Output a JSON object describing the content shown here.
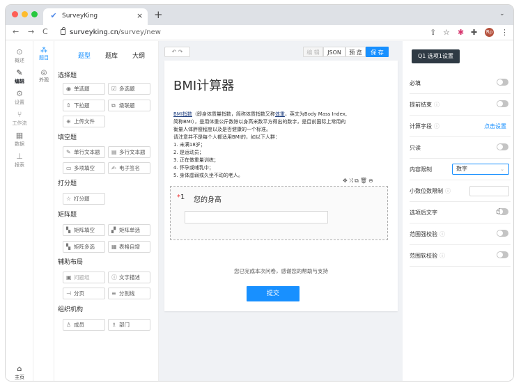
{
  "browser": {
    "tab_title": "SurveyKing",
    "tab_close": "×",
    "new_tab": "+",
    "tab_menu": "⌄",
    "nav": {
      "back": "←",
      "forward": "→",
      "reload": "C"
    },
    "url_host": "surveyking.cn",
    "url_path": "/survey/new",
    "ext_icons": [
      "⇧",
      "☆",
      "✱",
      "✚"
    ],
    "avatar": "Rp",
    "menu": "⋮",
    "traffic_light_colors": [
      "#fe5f57",
      "#febc2e",
      "#28c840"
    ]
  },
  "left_nav": {
    "items": [
      {
        "icon": "⊙",
        "label": "概述"
      },
      {
        "icon": "✎",
        "label": "编辑",
        "active": true
      },
      {
        "icon": "⚙",
        "label": "设置"
      },
      {
        "icon": "⑂",
        "label": "工作流"
      },
      {
        "icon": "▦",
        "label": "数据"
      },
      {
        "icon": "⊥",
        "label": "报表"
      }
    ],
    "home": {
      "icon": "⌂",
      "label": "主页"
    }
  },
  "sub_nav": {
    "items": [
      {
        "icon": "⁂",
        "label": "题目",
        "active": true
      },
      {
        "icon": "◎",
        "label": "外观"
      }
    ]
  },
  "palette": {
    "tabs": [
      "题型",
      "题库",
      "大纲"
    ],
    "groups": [
      {
        "title": "选择题",
        "items": [
          {
            "icon": "◉",
            "label": "单选题"
          },
          {
            "icon": "☑",
            "label": "多选题"
          },
          {
            "icon": "⇕",
            "label": "下拉题"
          },
          {
            "icon": "⧉",
            "label": "级联题"
          },
          {
            "icon": "⊕",
            "label": "上传文件"
          }
        ]
      },
      {
        "title": "填空题",
        "items": [
          {
            "icon": "✎",
            "label": "单行文本题"
          },
          {
            "icon": "▤",
            "label": "多行文本题"
          },
          {
            "icon": "▭",
            "label": "多项填空"
          },
          {
            "icon": "✍",
            "label": "电子签名"
          }
        ]
      },
      {
        "title": "打分题",
        "items": [
          {
            "icon": "☆",
            "label": "打分题"
          }
        ]
      },
      {
        "title": "矩阵题",
        "items": [
          {
            "icon": "▚",
            "label": "矩阵填空"
          },
          {
            "icon": "▞",
            "label": "矩阵单选"
          },
          {
            "icon": "▚",
            "label": "矩阵多选"
          },
          {
            "icon": "▦",
            "label": "表格自增"
          }
        ]
      },
      {
        "title": "辅助布局",
        "items": [
          {
            "icon": "▣",
            "label": "问题组",
            "disabled": true
          },
          {
            "icon": "ⓘ",
            "label": "文字描述"
          },
          {
            "icon": "⊣",
            "label": "分页"
          },
          {
            "icon": "≡",
            "label": "分割线"
          }
        ]
      },
      {
        "title": "组织机构",
        "items": [
          {
            "icon": "♙",
            "label": "成员"
          },
          {
            "icon": "♗",
            "label": "部门"
          }
        ]
      }
    ]
  },
  "canvas": {
    "undo": "↶ ↷",
    "toolbar": {
      "edit": "编 辑",
      "json": "JSON",
      "preview": "预 览",
      "save": "保 存"
    },
    "title": "BMI计算器",
    "desc_lines": [
      {
        "u1": "BMI指数",
        "t1": "（即身体质量指数，简称体质指数又称",
        "u2": "体重",
        "t2": "，英文为Body Mass Index,"
      },
      {
        "t": "简称BMI），是用体重公斤数除以身高米数平方得出的数字，是目前国际上常用的"
      },
      {
        "t": "衡量人体胖瘦程度以及是否健康的一个标准。"
      },
      {
        "t": "请注意并不是每个人都适用BMI的，如以下人群："
      },
      {
        "t": "1. 未满18岁；"
      },
      {
        "t": "2. 是运动员；"
      },
      {
        "t": "3. 正在做重量训练；"
      },
      {
        "t": "4. 怀孕或哺乳中；"
      },
      {
        "t": "5. 身体虚弱或久坐不动的老人。"
      }
    ],
    "question": {
      "tools": "✥⤨⧉🗑⊖",
      "star": "*",
      "number": "1",
      "title": "您的身高"
    },
    "end_text": "您已完成本次问卷，感谢您的帮助与支持",
    "submit": "提交"
  },
  "props": {
    "header": "Q1 选项1设置",
    "rows": [
      {
        "label": "必填",
        "control": "toggle"
      },
      {
        "label": "提前结束",
        "hint": "ⓘ",
        "control": "toggle"
      },
      {
        "label": "计算字段",
        "hint": "ⓘ",
        "control": "link",
        "link": "点击设置"
      },
      {
        "label": "只读",
        "control": "toggle"
      },
      {
        "label": "内容限制",
        "control": "select",
        "value": "数字"
      },
      {
        "label": "小数位数限制",
        "hint": "ⓘ",
        "control": "input"
      },
      {
        "label": "选项后文字",
        "control": "toggle"
      },
      {
        "label": "范围强校验",
        "hint": "ⓘ",
        "control": "toggle"
      },
      {
        "label": "范围软校验",
        "hint": "ⓘ",
        "control": "toggle"
      }
    ],
    "select_arrow": "⌄"
  },
  "colors": {
    "accent": "#1890ff",
    "header_dark": "#2f3a44",
    "toggle_off": "#c4c4c4"
  }
}
